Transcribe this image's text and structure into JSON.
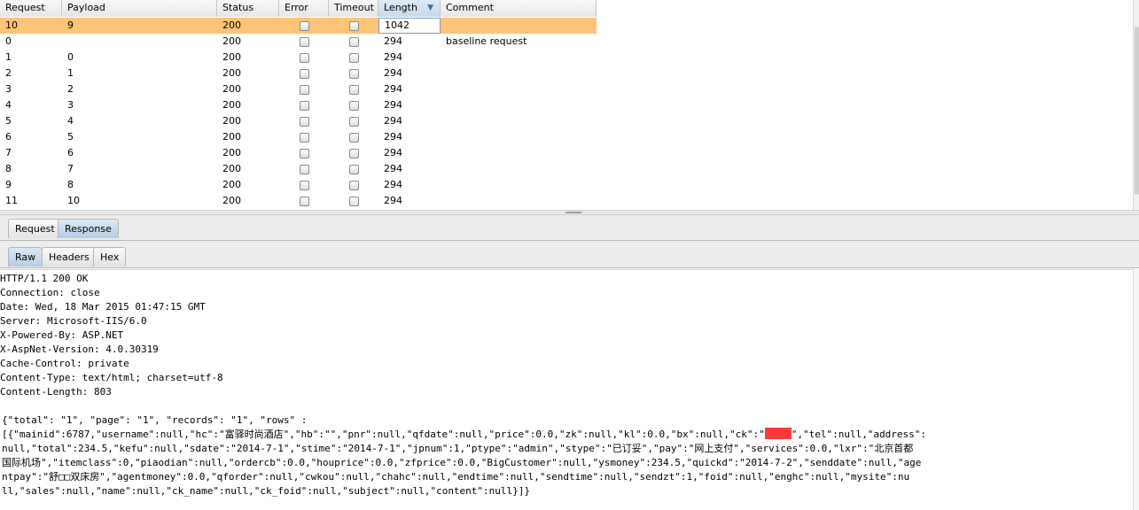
{
  "table": {
    "columns": [
      "Request",
      "Payload",
      "Status",
      "Error",
      "Timeout",
      "Length",
      "Comment"
    ],
    "sorted_column": "Length",
    "sort_direction": "descending",
    "rows": [
      {
        "request": "10",
        "payload": "9",
        "status": "200",
        "error": false,
        "timeout": false,
        "length": "1042",
        "comment": "",
        "selected": true
      },
      {
        "request": "0",
        "payload": "",
        "status": "200",
        "error": false,
        "timeout": false,
        "length": "294",
        "comment": "baseline request",
        "selected": false
      },
      {
        "request": "1",
        "payload": "0",
        "status": "200",
        "error": false,
        "timeout": false,
        "length": "294",
        "comment": "",
        "selected": false
      },
      {
        "request": "2",
        "payload": "1",
        "status": "200",
        "error": false,
        "timeout": false,
        "length": "294",
        "comment": "",
        "selected": false
      },
      {
        "request": "3",
        "payload": "2",
        "status": "200",
        "error": false,
        "timeout": false,
        "length": "294",
        "comment": "",
        "selected": false
      },
      {
        "request": "4",
        "payload": "3",
        "status": "200",
        "error": false,
        "timeout": false,
        "length": "294",
        "comment": "",
        "selected": false
      },
      {
        "request": "5",
        "payload": "4",
        "status": "200",
        "error": false,
        "timeout": false,
        "length": "294",
        "comment": "",
        "selected": false
      },
      {
        "request": "6",
        "payload": "5",
        "status": "200",
        "error": false,
        "timeout": false,
        "length": "294",
        "comment": "",
        "selected": false
      },
      {
        "request": "7",
        "payload": "6",
        "status": "200",
        "error": false,
        "timeout": false,
        "length": "294",
        "comment": "",
        "selected": false
      },
      {
        "request": "8",
        "payload": "7",
        "status": "200",
        "error": false,
        "timeout": false,
        "length": "294",
        "comment": "",
        "selected": false
      },
      {
        "request": "9",
        "payload": "8",
        "status": "200",
        "error": false,
        "timeout": false,
        "length": "294",
        "comment": "",
        "selected": false
      },
      {
        "request": "11",
        "payload": "10",
        "status": "200",
        "error": false,
        "timeout": false,
        "length": "294",
        "comment": "",
        "selected": false
      }
    ]
  },
  "tabs_top": {
    "items": [
      "Request",
      "Response"
    ],
    "active": "Response"
  },
  "tabs_view": {
    "items": [
      "Raw",
      "Headers",
      "Hex"
    ],
    "active": "Raw"
  },
  "response": {
    "header_lines": [
      "HTTP/1.1 200 OK",
      "Connection: close",
      "Date: Wed, 18 Mar 2015 01:47:15 GMT",
      "Server: Microsoft-IIS/6.0",
      "X-Powered-By: ASP.NET",
      "X-AspNet-Version: 4.0.30319",
      "Cache-Control: private",
      "Content-Type: text/html; charset=utf-8",
      "Content-Length: 803"
    ],
    "body_line_1": "{\"total\": \"1\", \"page\": \"1\", \"records\": \"1\", \"rows\" :",
    "body_line_2a": "[{\"mainid\":6787,\"username\":null,\"hc\":\"富驿时尚酒店\",\"hb\":\"\",\"pnr\":null,\"qfdate\":null,\"price\":0.0,\"zk\":null,\"kl\":0.0,\"bx\":null,\"ck\":\"",
    "body_line_2b": "\",\"tel\":null,\"address\":",
    "body_line_3": "null,\"total\":234.5,\"kefu\":null,\"sdate\":\"2014-7-1\",\"stime\":\"2014-7-1\",\"jpnum\":1,\"ptype\":\"admin\",\"stype\":\"已订妥\",\"pay\":\"网上支付\",\"services\":0.0,\"lxr\":\"北京首都",
    "body_line_4": "国际机场\",\"itemclass\":0,\"piaodian\":null,\"ordercb\":0.0,\"houprice\":0.0,\"zfprice\":0.0,\"BigCustomer\":null,\"ysmoney\":234.5,\"quickd\":\"2014-7-2\",\"senddate\":null,\"age",
    "body_line_5": "ntpay\":\"舒□□双床房\",\"agentmoney\":0.0,\"qforder\":null,\"cwkou\":null,\"chahc\":null,\"endtime\":null,\"sendtime\":null,\"sendzt\":1,\"foid\":null,\"enghc\":null,\"mysite\":nu",
    "body_line_6": "ll,\"sales\":null,\"name\":null,\"ck_name\":null,\"ck_foid\":null,\"subject\":null,\"content\":null}]}"
  }
}
